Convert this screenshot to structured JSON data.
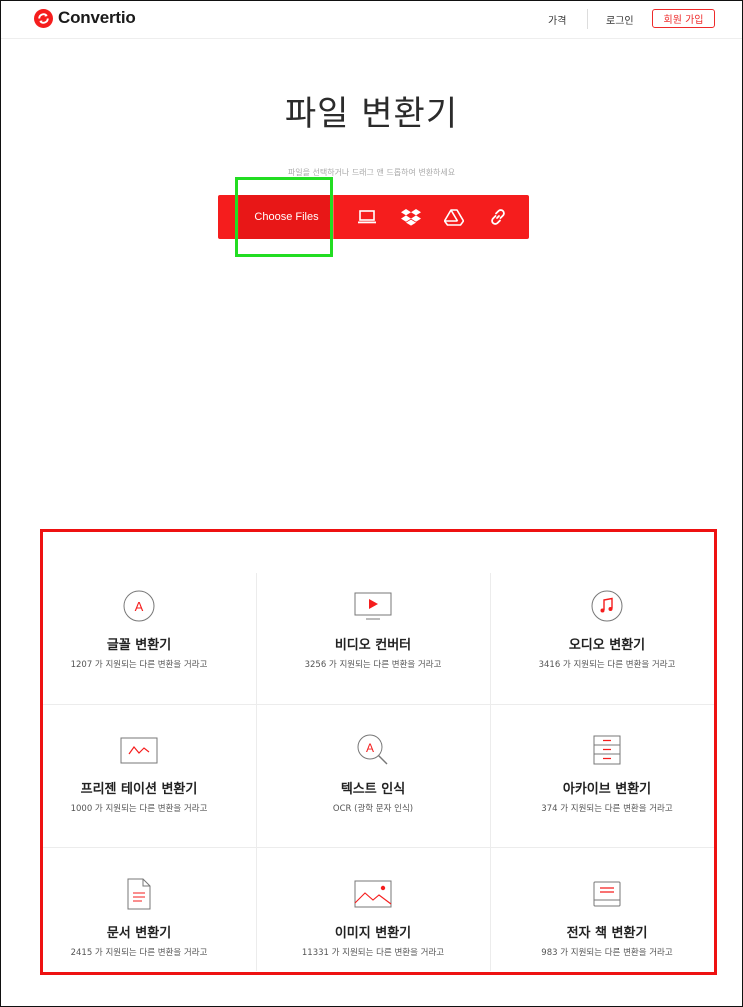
{
  "header": {
    "logo_text": "Convertio",
    "nav_price": "가격",
    "nav_login": "로그인",
    "nav_signup": "회원 가입"
  },
  "hero": {
    "title": "파일 변환기",
    "subtitle": "파일을 선택하거나 드래그 앤 드롭하여 변환하세요",
    "choose_label": "Choose Files",
    "sources": [
      "laptop-icon",
      "dropbox-icon",
      "google-drive-icon",
      "link-icon"
    ]
  },
  "colors": {
    "brand_red": "#f51d1d",
    "highlight_green": "#22dd22",
    "annotation_red": "#ee1111"
  },
  "converters": [
    {
      "icon": "font-icon",
      "name": "글꼴 변환기",
      "desc": "1207 가 지원되는 다른 변환을 거라고"
    },
    {
      "icon": "video-icon",
      "name": "비디오 컨버터",
      "desc": "3256 가 지원되는 다른 변환을 거라고"
    },
    {
      "icon": "audio-icon",
      "name": "오디오 변환기",
      "desc": "3416 가 지원되는 다른 변환을 거라고"
    },
    {
      "icon": "presentation-icon",
      "name": "프리젠 테이션 변환기",
      "desc": "1000 가 지원되는 다른 변환을 거라고"
    },
    {
      "icon": "ocr-icon",
      "name": "텍스트 인식",
      "desc": "OCR (광학 문자 인식)"
    },
    {
      "icon": "archive-icon",
      "name": "아카이브 변환기",
      "desc": "374 가 지원되는 다른 변환을 거라고"
    },
    {
      "icon": "document-icon",
      "name": "문서 변환기",
      "desc": "2415 가 지원되는 다른 변환을 거라고"
    },
    {
      "icon": "image-icon",
      "name": "이미지 변환기",
      "desc": "11331 가 지원되는 다른 변환을 거라고"
    },
    {
      "icon": "ebook-icon",
      "name": "전자 책 변환기",
      "desc": "983 가 지원되는 다른 변환을 거라고"
    }
  ]
}
